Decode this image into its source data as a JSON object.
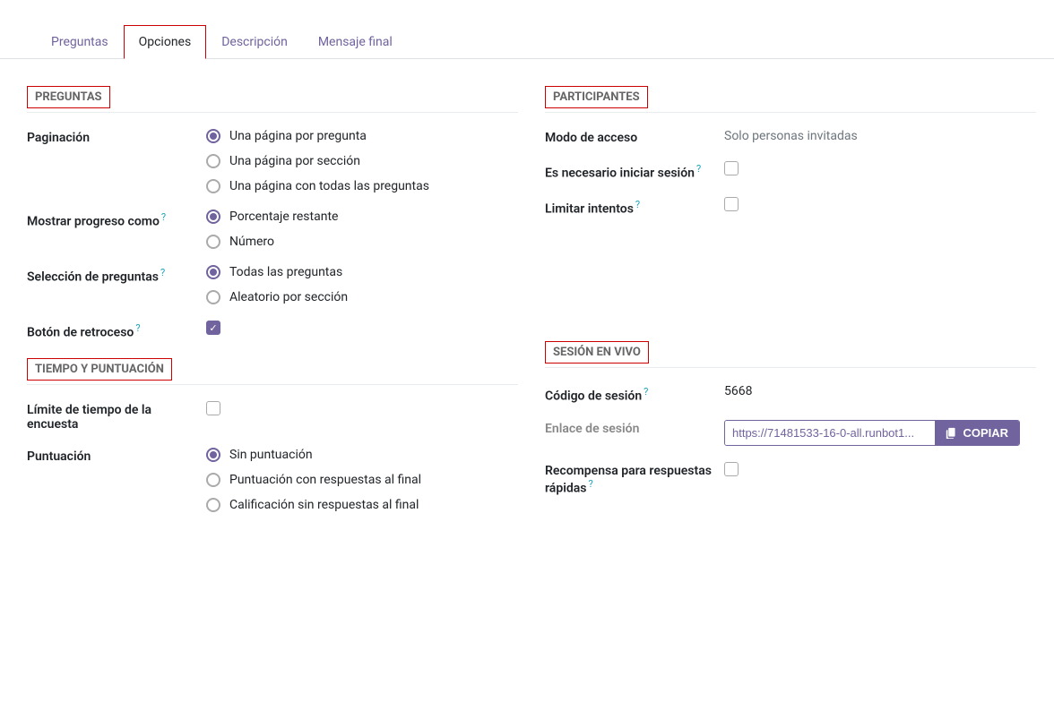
{
  "tabs": {
    "questions": "Preguntas",
    "options": "Opciones",
    "description": "Descripción",
    "final_message": "Mensaje final"
  },
  "sections": {
    "questions": "PREGUNTAS",
    "time_scoring": "TIEMPO Y PUNTUACIÓN",
    "participants": "PARTICIPANTES",
    "live_session": "SESIÓN EN VIVO"
  },
  "fields": {
    "pagination": {
      "label": "Paginación",
      "opt1": "Una página por pregunta",
      "opt2": "Una página por sección",
      "opt3": "Una página con todas las preguntas"
    },
    "progress": {
      "label": "Mostrar progreso como",
      "opt1": "Porcentaje restante",
      "opt2": "Número"
    },
    "selection": {
      "label": "Selección de preguntas",
      "opt1": "Todas las preguntas",
      "opt2": "Aleatorio por sección"
    },
    "back_button": {
      "label": "Botón de retroceso"
    },
    "time_limit": {
      "label": "Límite de tiempo de la encuesta"
    },
    "scoring": {
      "label": "Puntuación",
      "opt1": "Sin puntuación",
      "opt2": "Puntuación con respuestas al final",
      "opt3": "Calificación sin respuestas al final"
    },
    "access_mode": {
      "label": "Modo de acceso",
      "value": "Solo personas invitadas"
    },
    "login_required": {
      "label": "Es necesario iniciar sesión"
    },
    "limit_attempts": {
      "label": "Limitar intentos"
    },
    "session_code": {
      "label": "Código de sesión",
      "value": "5668"
    },
    "session_link": {
      "label": "Enlace de sesión",
      "value": "https://71481533-16-0-all.runbot1...",
      "copy": "COPIAR"
    },
    "fast_reward": {
      "label": "Recompensa para respuestas rápidas"
    }
  },
  "help": "?"
}
